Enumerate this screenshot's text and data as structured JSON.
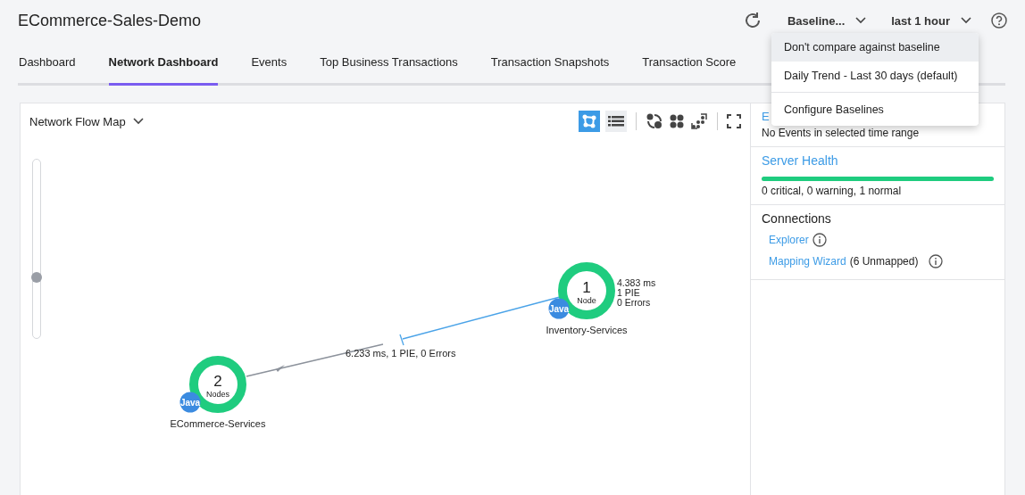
{
  "app_title": "ECommerce-Sales-Demo",
  "header": {
    "baseline": "Baseline...",
    "time_range": "last 1 hour"
  },
  "tabs": [
    {
      "label": "Dashboard",
      "selected": false
    },
    {
      "label": "Network Dashboard",
      "selected": true
    },
    {
      "label": "Events",
      "selected": false
    },
    {
      "label": "Top Business Transactions",
      "selected": false
    },
    {
      "label": "Transaction Snapshots",
      "selected": false
    },
    {
      "label": "Transaction Score",
      "selected": false
    }
  ],
  "baseline_menu": [
    {
      "label": "Don't compare against baseline",
      "selected": true
    },
    {
      "label": "Daily Trend - Last 30 days (default)",
      "selected": false
    },
    {
      "label": "Configure Baselines",
      "selected": false
    }
  ],
  "map": {
    "title": "Network Flow Map",
    "views": [
      {
        "kind": "flow",
        "selected": true
      },
      {
        "kind": "list",
        "selected": false
      }
    ],
    "zoom": {
      "level": 0.33
    },
    "nodes": [
      {
        "count": "1",
        "unit": "Node",
        "name": "Inventory-Services",
        "badge": "Java",
        "metrics": [
          "4.383 ms",
          "1 PIE",
          "0 Errors"
        ]
      },
      {
        "count": "2",
        "unit": "Nodes",
        "name": "ECommerce-Services",
        "badge": "Java"
      }
    ],
    "edge_label": "6.233 ms, 1 PIE, 0 Errors"
  },
  "side": {
    "events_title": "E",
    "events_text": "No Events in selected time range",
    "health_title": "Server Health",
    "health": {
      "level": 1
    },
    "health_text": "0 critical, 0 warning, 1 normal",
    "connections_title": "Connections",
    "links": [
      {
        "label": "Explorer"
      },
      {
        "label": "Mapping Wizard",
        "note": "(6 Unmapped)"
      }
    ]
  }
}
